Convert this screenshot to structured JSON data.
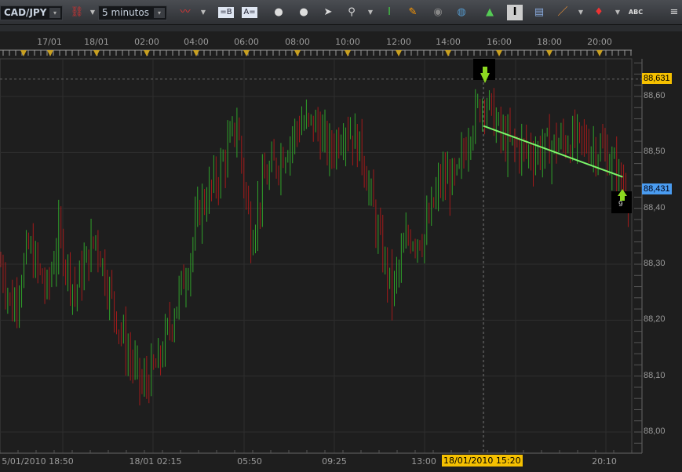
{
  "toolbar": {
    "symbol": "CAD/JPY",
    "interval": "5 minutos",
    "icons": [
      "unlink-icon",
      "chart-type-icon",
      "layout-b-icon",
      "layout-a-icon",
      "zoom-in-icon",
      "zoom-out-icon",
      "cursor-icon",
      "zoom-vertical-icon",
      "fit-vertical-icon",
      "draw-icon",
      "eye-icon",
      "globe-icon",
      "add-image-icon",
      "text-cursor-icon",
      "indicator-panel-icon",
      "pencil-icon",
      "marker-icon",
      "add-text-icon",
      "menu-icon"
    ]
  },
  "top_axis": [
    "17/01",
    "18/01",
    "02:00",
    "04:00",
    "06:00",
    "08:00",
    "10:00",
    "12:00",
    "14:00",
    "16:00",
    "18:00",
    "20:00"
  ],
  "bottom_axis": [
    "5/01/2010 18:50",
    "18/01 02:15",
    "05:50",
    "09:25",
    "13:00",
    "20:10"
  ],
  "cursor_time": "18/01/2010 15:20",
  "price_badges": {
    "high": "88,631",
    "current": "88,431"
  },
  "marker_count": "9",
  "colors": {
    "up": "#2fa12a",
    "down": "#a21a1a",
    "trendline": "#7cf56a",
    "high_badge": "#f5c000",
    "current_badge": "#4a9cf0"
  },
  "chart_data": {
    "type": "ohlc",
    "instrument": "CAD/JPY",
    "bar_interval_minutes": 5,
    "y_ticks": [
      "88,00",
      "88,10",
      "88,20",
      "88,30",
      "88,40",
      "88,50",
      "88,60"
    ],
    "ylim": [
      87.965,
      88.67
    ],
    "y_tick_values": [
      88.0,
      88.1,
      88.2,
      88.3,
      88.4,
      88.5,
      88.6
    ],
    "bar_count": 272,
    "price_path": [
      [
        0,
        88.3
      ],
      [
        5,
        88.22
      ],
      [
        12,
        88.33
      ],
      [
        20,
        88.25
      ],
      [
        25,
        88.35
      ],
      [
        32,
        88.25
      ],
      [
        41,
        88.35
      ],
      [
        47,
        88.25
      ],
      [
        54,
        88.15
      ],
      [
        61,
        88.08
      ],
      [
        68,
        88.12
      ],
      [
        75,
        88.22
      ],
      [
        81,
        88.3
      ],
      [
        86,
        88.4
      ],
      [
        93,
        88.45
      ],
      [
        102,
        88.55
      ],
      [
        108,
        88.35
      ],
      [
        114,
        88.45
      ],
      [
        122,
        88.5
      ],
      [
        129,
        88.55
      ],
      [
        136,
        88.55
      ],
      [
        142,
        88.5
      ],
      [
        149,
        88.55
      ],
      [
        156,
        88.5
      ],
      [
        163,
        88.35
      ],
      [
        169,
        88.25
      ],
      [
        176,
        88.35
      ],
      [
        183,
        88.35
      ],
      [
        190,
        88.45
      ],
      [
        197,
        88.45
      ],
      [
        203,
        88.55
      ],
      [
        209,
        88.6
      ],
      [
        217,
        88.52
      ],
      [
        230,
        88.5
      ],
      [
        244,
        88.52
      ],
      [
        251,
        88.52
      ],
      [
        261,
        88.5
      ],
      [
        270,
        88.43
      ]
    ],
    "high_price": 88.631,
    "current_price": 88.431,
    "trendline": {
      "start": [
        209,
        88.547
      ],
      "end": [
        270,
        88.456
      ]
    }
  }
}
